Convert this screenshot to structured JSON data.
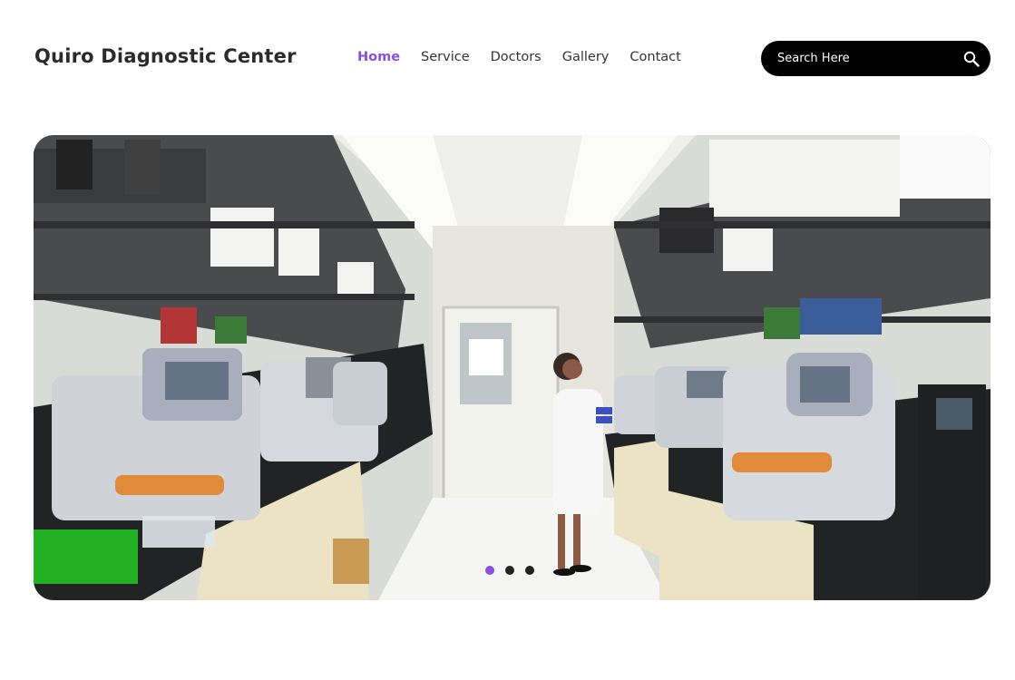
{
  "header": {
    "brand": "Quiro Diagnostic Center"
  },
  "nav": {
    "items": [
      {
        "label": "Home",
        "active": true
      },
      {
        "label": "Service",
        "active": false
      },
      {
        "label": "Doctors",
        "active": false
      },
      {
        "label": "Gallery",
        "active": false
      },
      {
        "label": "Contact",
        "active": false
      }
    ]
  },
  "search": {
    "placeholder": "Search Here",
    "value": "",
    "icon": "search-icon"
  },
  "hero": {
    "image": "laboratory-photo",
    "slides_total": 3,
    "active_slide": 1
  },
  "colors": {
    "accent": "#8a4fdc",
    "text": "#2b2b2b",
    "search_bg": "#000000"
  }
}
